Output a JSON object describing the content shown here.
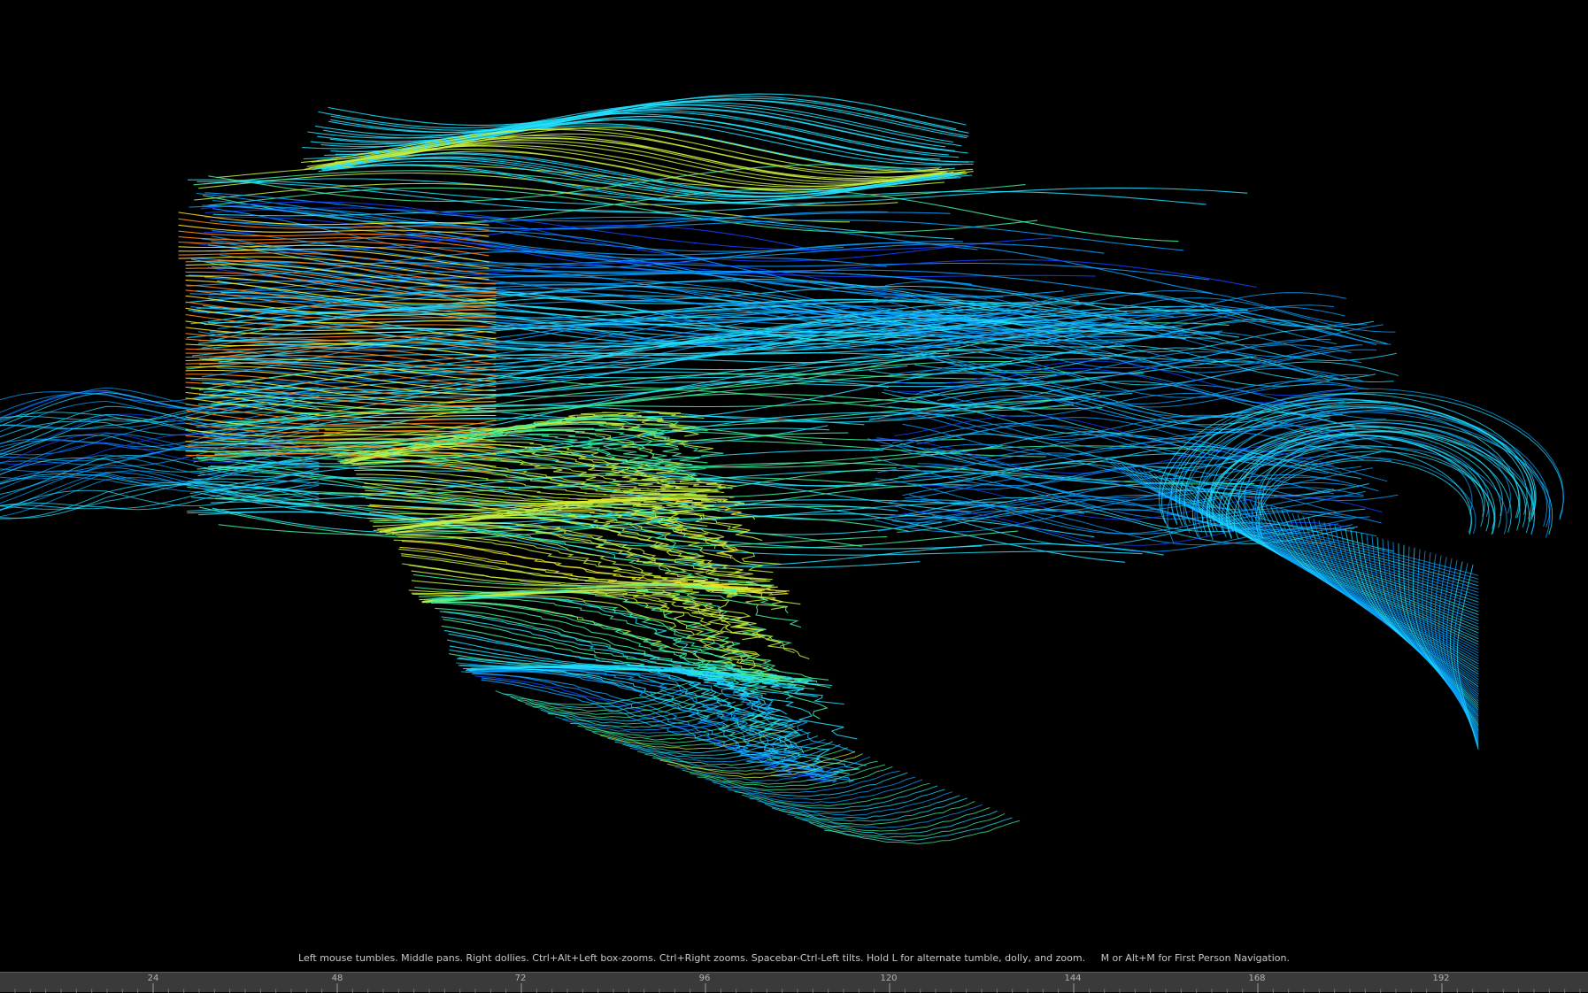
{
  "viewport": {
    "background": "#000000",
    "navigation_hint": "Left mouse tumbles. Middle pans. Right dollies. Ctrl+Alt+Left box-zooms. Ctrl+Right zooms. Spacebar-Ctrl-Left tilts. Hold L for alternate tumble, dolly, and zoom.     M or Alt+M for First Person Navigation.",
    "colormap": [
      "#1440ff",
      "#0aa0ff",
      "#22e0ff",
      "#40f0a0",
      "#c8f040",
      "#ffe020",
      "#ff8010",
      "#ff3000"
    ]
  },
  "timeline": {
    "background": "#3a3a3a",
    "tick_labels": [
      "24",
      "48",
      "72",
      "96",
      "120",
      "144",
      "168",
      "192"
    ]
  }
}
